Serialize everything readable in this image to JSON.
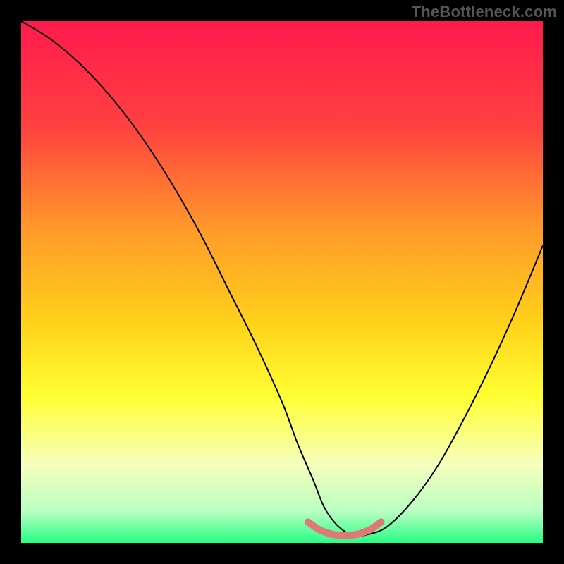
{
  "watermark": "TheBottleneck.com",
  "chart_data": {
    "type": "line",
    "title": "",
    "xlabel": "",
    "ylabel": "",
    "xlim": [
      0,
      100
    ],
    "ylim": [
      0,
      100
    ],
    "background_gradient": {
      "stops": [
        {
          "offset": 0,
          "color": "#ff1a4d"
        },
        {
          "offset": 20,
          "color": "#ff4040"
        },
        {
          "offset": 40,
          "color": "#ff9a2a"
        },
        {
          "offset": 58,
          "color": "#ffd21a"
        },
        {
          "offset": 72,
          "color": "#ffff33"
        },
        {
          "offset": 85,
          "color": "#f6ffbd"
        },
        {
          "offset": 94,
          "color": "#b8ffc2"
        },
        {
          "offset": 100,
          "color": "#26ff84"
        }
      ]
    },
    "series": [
      {
        "name": "bottleneck-curve",
        "color": "#000000",
        "x": [
          0,
          5,
          10,
          15,
          20,
          25,
          30,
          35,
          40,
          45,
          50,
          53,
          56,
          58,
          60,
          62,
          64,
          66,
          70,
          75,
          80,
          85,
          90,
          95,
          100
        ],
        "y": [
          100,
          97,
          93,
          88,
          82,
          75,
          67,
          58,
          48,
          38,
          27,
          19,
          12,
          7,
          4,
          2.2,
          1.3,
          1.5,
          3,
          8,
          15,
          24,
          34,
          45,
          57
        ]
      }
    ],
    "highlight": {
      "name": "optimal-zone",
      "color": "#e07878",
      "x": [
        55,
        57,
        59,
        61,
        63,
        65,
        67,
        69
      ],
      "y": [
        4.0,
        2.6,
        1.8,
        1.4,
        1.4,
        1.8,
        2.6,
        4.0
      ]
    }
  }
}
